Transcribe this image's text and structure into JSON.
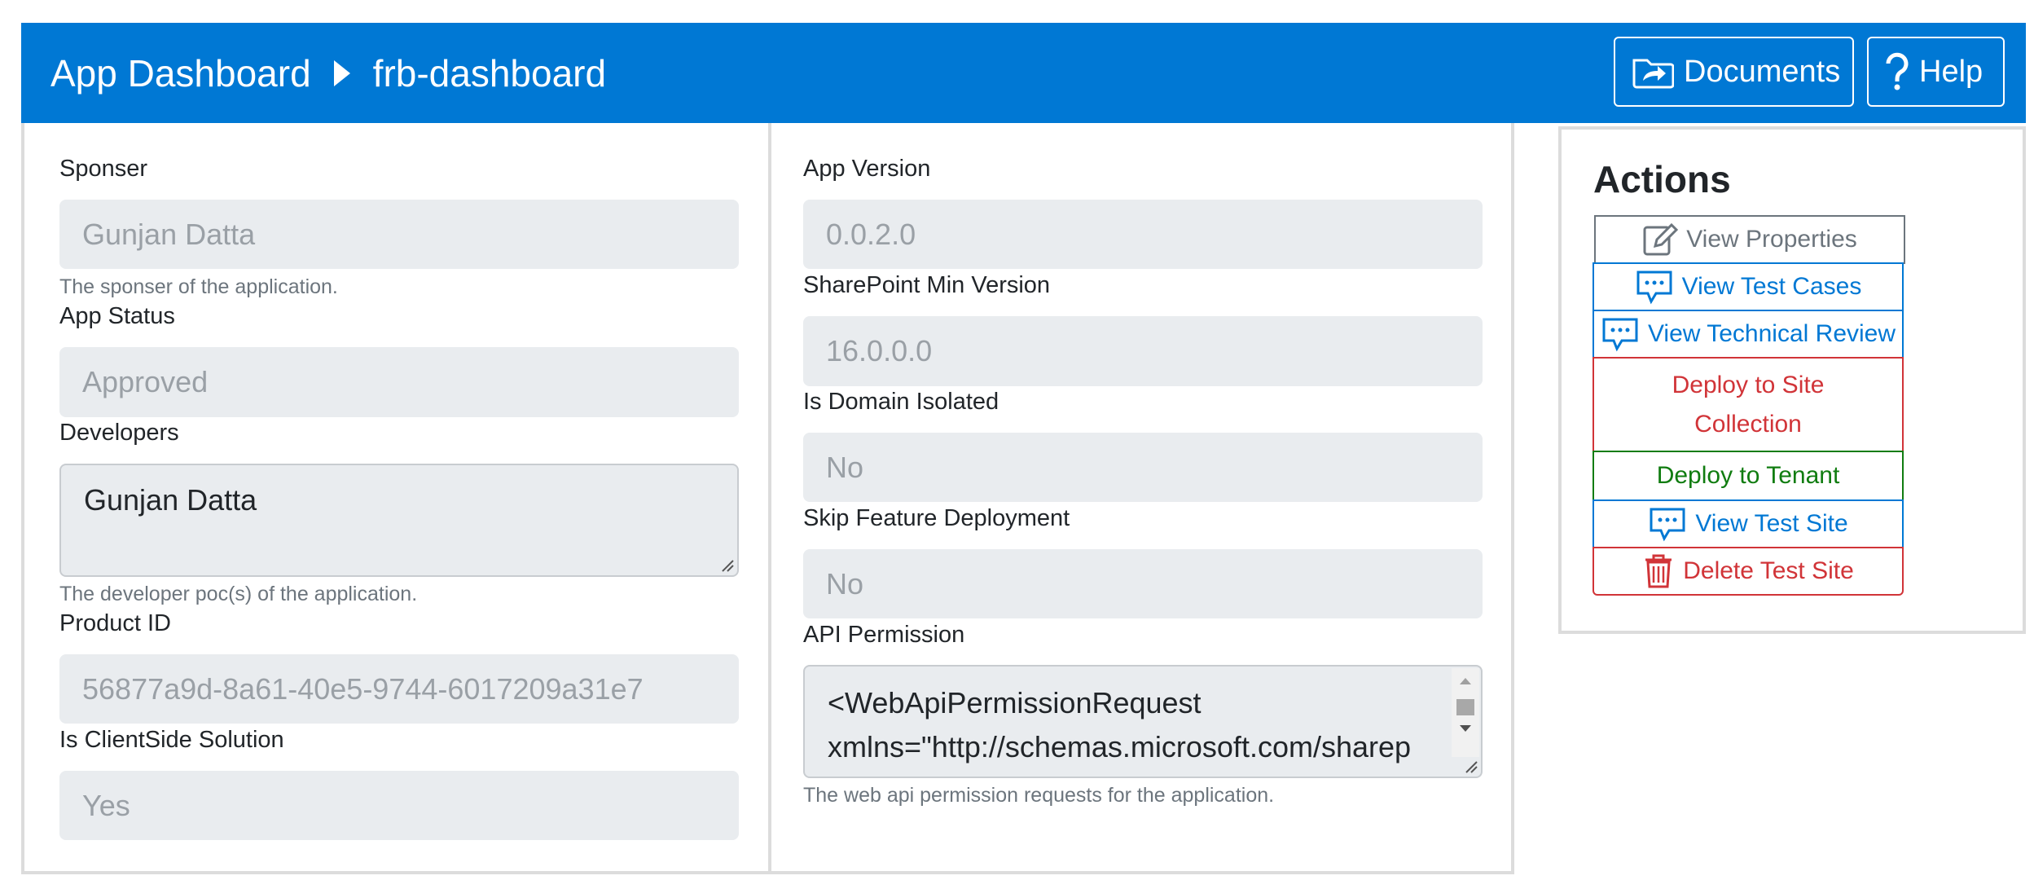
{
  "header": {
    "breadcrumb_root": "App Dashboard",
    "breadcrumb_current": "frb-dashboard",
    "documents_label": "Documents",
    "help_label": "Help"
  },
  "left": {
    "sponser_label": "Sponser",
    "sponser_value": "Gunjan Datta",
    "sponser_help": "The sponser of the application.",
    "status_label": "App Status",
    "status_value": "Approved",
    "developers_label": "Developers",
    "developers_value": "Gunjan Datta",
    "developers_help": "The developer poc(s) of the application.",
    "product_id_label": "Product ID",
    "product_id_value": "56877a9d-8a61-40e5-9744-6017209a31e7",
    "clientside_label": "Is ClientSide Solution",
    "clientside_value": "Yes"
  },
  "right": {
    "version_label": "App Version",
    "version_value": "0.0.2.0",
    "sp_min_label": "SharePoint Min Version",
    "sp_min_value": "16.0.0.0",
    "domain_isolated_label": "Is Domain Isolated",
    "domain_isolated_value": "No",
    "skip_feature_label": "Skip Feature Deployment",
    "skip_feature_value": "No",
    "api_permission_label": "API Permission",
    "api_permission_line1": "<WebApiPermissionRequest",
    "api_permission_line2": "xmlns=\"http://schemas.microsoft.com/sharep",
    "api_permission_help": "The web api permission requests for the application."
  },
  "actions": {
    "title": "Actions",
    "view_properties": "View Properties",
    "view_test_cases": "View Test Cases",
    "view_technical_review": "View Technical Review",
    "deploy_site_collection_1": "Deploy to Site",
    "deploy_site_collection_2": "Collection",
    "deploy_tenant": "Deploy to Tenant",
    "view_test_site": "View Test Site",
    "delete_test_site": "Delete Test Site"
  },
  "colors": {
    "header_bg": "#0078d4",
    "primary": "#0078d4",
    "danger": "#d13438",
    "success": "#107c10",
    "secondary": "#6c757d"
  }
}
